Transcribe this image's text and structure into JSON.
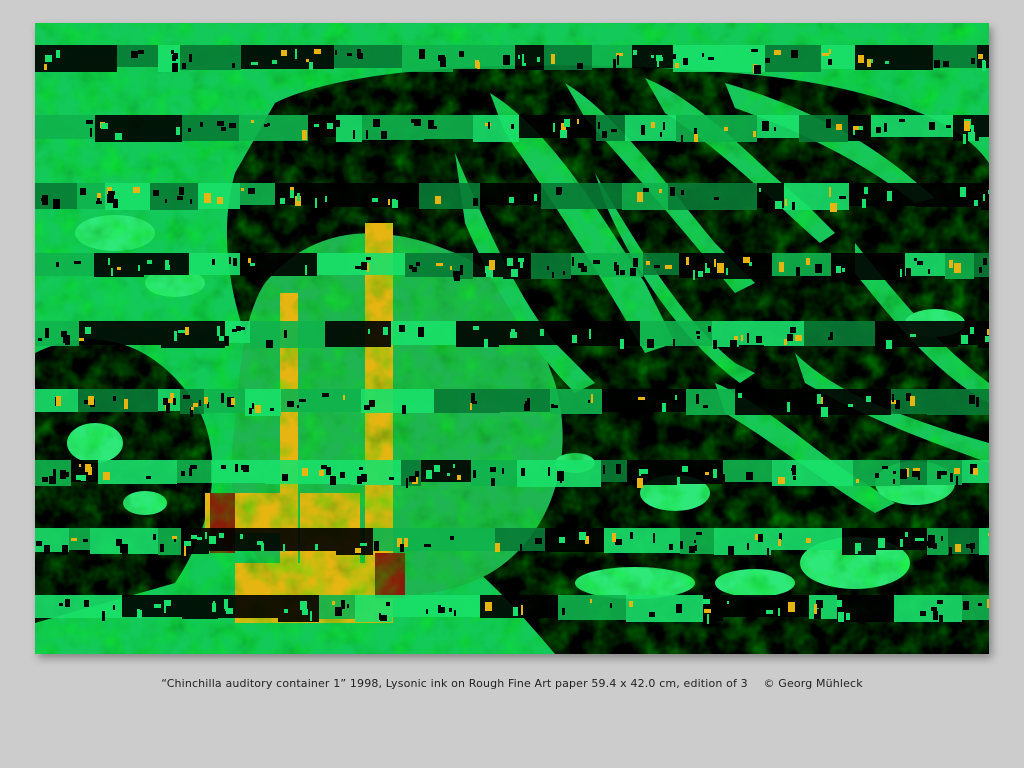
{
  "artwork": {
    "colors": {
      "green": "#19e06a",
      "mid_green": "#0fb24c",
      "dark_green": "#087a35",
      "black": "#000000",
      "yellow": "#e6b512",
      "red": "#8a1d0a"
    }
  },
  "caption": {
    "text": "“Chinchilla auditory container 1” 1998, Lysonic ink on Rough Fine Art paper 59.4 x 42.0 cm, edition of 3",
    "copyright": "© Georg Mühleck"
  }
}
